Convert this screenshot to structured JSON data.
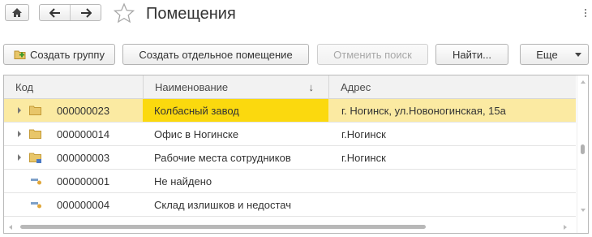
{
  "window": {
    "title": "Помещения"
  },
  "nav": {
    "home_icon": "home-icon",
    "back_icon": "arrow-left-icon",
    "forward_icon": "arrow-right-icon",
    "favorite_icon": "star-icon",
    "menu_icon": "more-vertical-icon"
  },
  "toolbar": {
    "create_group": "Создать группу",
    "create_room": "Создать отдельное помещение",
    "cancel_search": "Отменить поиск",
    "find": "Найти...",
    "more": "Еще"
  },
  "table": {
    "columns": [
      "Код",
      "Наименование",
      "Адрес"
    ],
    "sort_indicator": "↓",
    "rows": [
      {
        "type": "group",
        "code": "000000023",
        "name": "Колбасный завод",
        "address": "г. Ногинск, ул.Новоногинская, 15а"
      },
      {
        "type": "group",
        "code": "000000014",
        "name": "Офис в Ногинске",
        "address": "г.Ногинск"
      },
      {
        "type": "group-marked",
        "code": "000000003",
        "name": "Рабочие места сотрудников",
        "address": "г.Ногинск"
      },
      {
        "type": "item",
        "code": "000000001",
        "name": "Не найдено",
        "address": ""
      },
      {
        "type": "item",
        "code": "000000004",
        "name": "Склад излишков и недостач",
        "address": ""
      }
    ]
  },
  "colors": {
    "selected_row": "#fbeaa2",
    "current_cell": "#fbd90e",
    "folder": "#e8c66a"
  }
}
